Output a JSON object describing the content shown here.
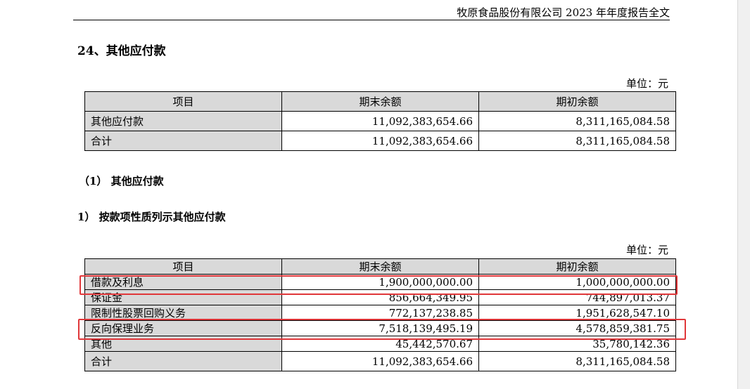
{
  "header": {
    "title": "牧原食品股份有限公司 2023 年年度报告全文"
  },
  "section": {
    "title": "24、其他应付款"
  },
  "unit_label": "单位：元",
  "summary_table": {
    "headers": [
      "项目",
      "期末余额",
      "期初余额"
    ],
    "rows": [
      [
        "其他应付款",
        "11,092,383,654.66",
        "8,311,165,084.58"
      ],
      [
        "合计",
        "11,092,383,654.66",
        "8,311,165,084.58"
      ]
    ]
  },
  "subheading1": "（1） 其他应付款",
  "subheading2": "1） 按款项性质列示其他应付款",
  "detail_table": {
    "headers": [
      "项目",
      "期末余额",
      "期初余额"
    ],
    "rows": [
      [
        "借款及利息",
        "1,900,000,000.00",
        "1,000,000,000.00"
      ],
      [
        "保证金",
        "856,664,349.95",
        "744,897,013.37"
      ],
      [
        "限制性股票回购义务",
        "772,137,238.85",
        "1,951,628,547.10"
      ],
      [
        "反向保理业务",
        "7,518,139,495.19",
        "4,578,859,381.75"
      ],
      [
        "其他",
        "45,442,570.67",
        "35,780,142.36"
      ],
      [
        "合计",
        "11,092,383,654.66",
        "8,311,165,084.58"
      ]
    ]
  },
  "highlight_color": "#e0373a"
}
